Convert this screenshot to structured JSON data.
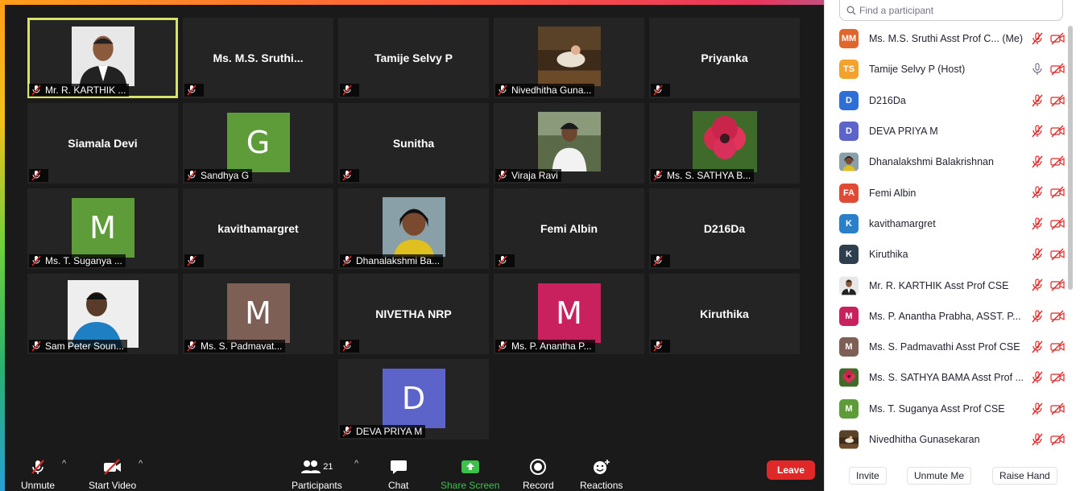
{
  "grid_tiles": [
    {
      "kind": "photo",
      "photo": "man-portrait",
      "label": "Mr. R. KARTHIK ...",
      "active": true
    },
    {
      "kind": "name",
      "center": "Ms.  M.S. Sruthi...",
      "label": ""
    },
    {
      "kind": "name",
      "center": "Tamije Selvy P",
      "label": ""
    },
    {
      "kind": "photo",
      "photo": "painting",
      "label": "Nivedhitha Guna..."
    },
    {
      "kind": "name",
      "center": "Priyanka",
      "label": ""
    },
    {
      "kind": "name",
      "center": "Siamala Devi",
      "label": ""
    },
    {
      "kind": "letter",
      "letter": "G",
      "color": "#5e9c3a",
      "label": "Sandhya G"
    },
    {
      "kind": "name",
      "center": "Sunitha",
      "label": ""
    },
    {
      "kind": "photo",
      "photo": "woman-outdoor",
      "label": "Viraja Ravi"
    },
    {
      "kind": "photo",
      "photo": "flower",
      "label": "Ms. S. SATHYA B..."
    },
    {
      "kind": "letter",
      "letter": "M",
      "color": "#5e9c3a",
      "label": "Ms. T. Suganya ..."
    },
    {
      "kind": "name",
      "center": "kavithamargret",
      "label": ""
    },
    {
      "kind": "photo",
      "photo": "woman-selfie",
      "label": "Dhanalakshmi Ba..."
    },
    {
      "kind": "name",
      "center": "Femi Albin",
      "label": ""
    },
    {
      "kind": "name",
      "center": "D216Da",
      "label": ""
    },
    {
      "kind": "photo",
      "photo": "man-blue",
      "label": "Sam Peter Soun..."
    },
    {
      "kind": "letter",
      "letter": "M",
      "color": "#7d5f55",
      "label": "Ms. S. Padmavat..."
    },
    {
      "kind": "name",
      "center": "NIVETHA NRP",
      "label": ""
    },
    {
      "kind": "letter",
      "letter": "M",
      "color": "#c8215e",
      "label": "Ms. P. Anantha P..."
    },
    {
      "kind": "name",
      "center": "Kiruthika",
      "label": ""
    },
    {
      "kind": "empty"
    },
    {
      "kind": "empty"
    },
    {
      "kind": "letter",
      "letter": "D",
      "color": "#5c64c9",
      "label": "DEVA PRIYA M"
    }
  ],
  "toolbar": {
    "unmute": "Unmute",
    "start_video": "Start Video",
    "participants": "Participants",
    "participants_count": "21",
    "chat": "Chat",
    "share_screen": "Share Screen",
    "record": "Record",
    "reactions": "Reactions",
    "leave": "Leave"
  },
  "panel": {
    "search_placeholder": "Find a participant",
    "participants": [
      {
        "initials": "MM",
        "color": "#e0662c",
        "name": "Ms. M.S. Sruthi Asst Prof C... (Me)",
        "mic": "off"
      },
      {
        "initials": "TS",
        "color": "#f2a32d",
        "name": "Tamije Selvy P (Host)",
        "mic": "on"
      },
      {
        "initials": "D",
        "color": "#2d6fd6",
        "name": "D216Da",
        "mic": "off"
      },
      {
        "initials": "D",
        "color": "#5c64c9",
        "name": "DEVA PRIYA M",
        "mic": "off"
      },
      {
        "initials": "",
        "photo": "woman-selfie",
        "name": "Dhanalakshmi Balakrishnan",
        "mic": "off"
      },
      {
        "initials": "FA",
        "color": "#e04b36",
        "name": "Femi Albin",
        "mic": "off"
      },
      {
        "initials": "K",
        "color": "#2a7fc9",
        "name": "kavithamargret",
        "mic": "off"
      },
      {
        "initials": "K",
        "color": "#2f3e4e",
        "name": "Kiruthika",
        "mic": "off"
      },
      {
        "initials": "",
        "photo": "man-portrait",
        "name": "Mr. R. KARTHIK Asst Prof CSE",
        "mic": "off"
      },
      {
        "initials": "M",
        "color": "#c8215e",
        "name": "Ms. P. Anantha Prabha, ASST. P...",
        "mic": "off"
      },
      {
        "initials": "M",
        "color": "#7d5f55",
        "name": "Ms. S. Padmavathi Asst Prof CSE",
        "mic": "off"
      },
      {
        "initials": "",
        "photo": "flower",
        "name": "Ms. S. SATHYA BAMA Asst Prof ...",
        "mic": "off"
      },
      {
        "initials": "M",
        "color": "#5e9c3a",
        "name": "Ms. T. Suganya Asst Prof CSE",
        "mic": "off"
      },
      {
        "initials": "",
        "photo": "painting",
        "name": "Nivedhitha Gunasekaran",
        "mic": "off"
      }
    ],
    "invite": "Invite",
    "unmute_me": "Unmute Me",
    "raise_hand": "Raise Hand"
  }
}
